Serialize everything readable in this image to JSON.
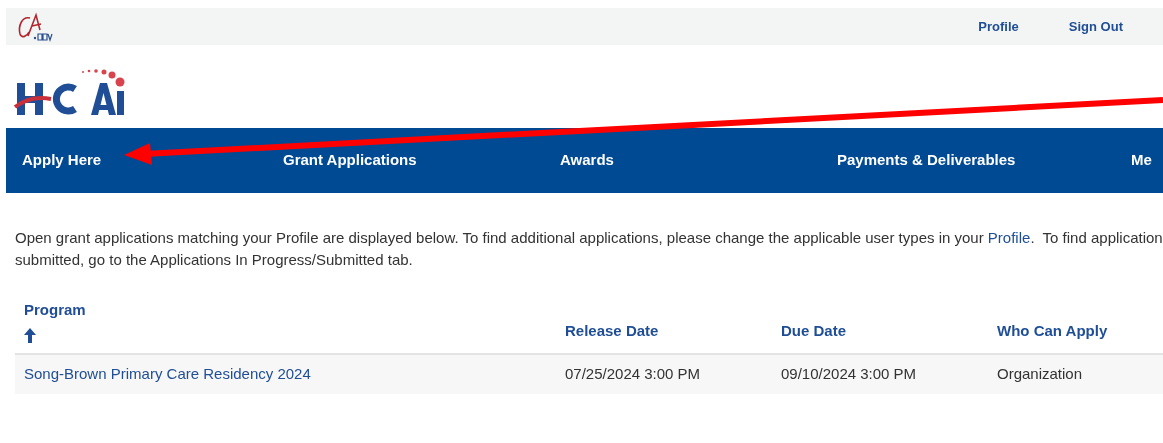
{
  "top_bar": {
    "links": [
      "Profile",
      "Sign Out"
    ]
  },
  "nav": {
    "items": [
      {
        "label": "Apply Here"
      },
      {
        "label": "Grant Applications"
      },
      {
        "label": "Awards"
      },
      {
        "label": "Payments & Deliverables"
      },
      {
        "label": "Me"
      }
    ]
  },
  "intro": {
    "before_link": "Open grant applications matching your Profile are displayed below. To find additional applications, please change the applicable user types in your ",
    "link": "Profile",
    "after_link": ".  To find application",
    "line_2": "submitted, go to the Applications In Progress/Submitted tab."
  },
  "table": {
    "columns": [
      {
        "label": "Program",
        "sorted": true
      },
      {
        "label": "Release Date"
      },
      {
        "label": "Due Date"
      },
      {
        "label": "Who Can Apply"
      }
    ],
    "rows": [
      [
        "Song-Brown Primary Care Residency 2024",
        "07/25/2024 3:00 PM",
        "09/10/2024 3:00 PM",
        "Organization"
      ]
    ]
  }
}
